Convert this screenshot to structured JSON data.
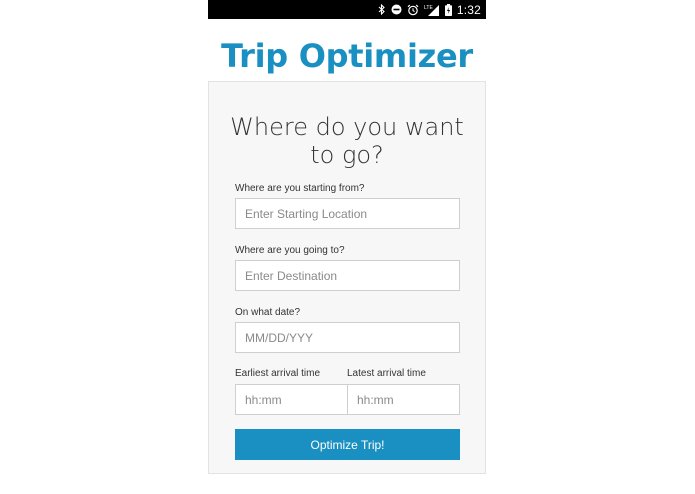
{
  "status_bar": {
    "time": "1:32",
    "icons": [
      "bluetooth-icon",
      "do-not-disturb-icon",
      "alarm-icon",
      "lte-signal-icon",
      "battery-charging-icon"
    ],
    "network_label": "LTE"
  },
  "app": {
    "title": "Trip Optimizer",
    "accent_color": "#1a8fc1"
  },
  "form": {
    "heading": "Where do you want to go?",
    "start": {
      "label": "Where are you starting from?",
      "placeholder": "Enter Starting Location",
      "value": ""
    },
    "destination": {
      "label": "Where are you going to?",
      "placeholder": "Enter Destination",
      "value": ""
    },
    "date": {
      "label": "On what date?",
      "placeholder": "MM/DD/YYY",
      "value": ""
    },
    "earliest_arrival": {
      "label": "Earliest arrival time",
      "placeholder": "hh:mm",
      "value": ""
    },
    "latest_arrival": {
      "label": "Latest arrival time",
      "placeholder": "hh:mm",
      "value": ""
    },
    "submit_label": "Optimize Trip!"
  }
}
